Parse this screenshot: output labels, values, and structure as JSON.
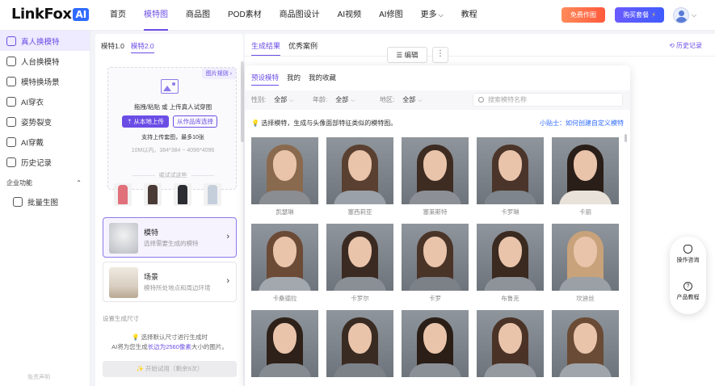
{
  "header": {
    "logo_text": "LinkFox",
    "logo_badge": "AI",
    "nav": [
      "首页",
      "模特图",
      "商品图",
      "POD素材",
      "商品图设计",
      "AI视频",
      "AI修图",
      "更多",
      "教程"
    ],
    "nav_active_index": 1,
    "more_caret": "⌵",
    "free_button": "免费作图",
    "buy_button": "购买套餐",
    "buy_icon": "⚡",
    "avatar_caret": "⌵"
  },
  "sidebar": {
    "items": [
      {
        "label": "真人换模特",
        "icon": "swap-person-icon"
      },
      {
        "label": "人台换模特",
        "icon": "mannequin-icon"
      },
      {
        "label": "模特换场景",
        "icon": "scene-icon"
      },
      {
        "label": "AI穿衣",
        "icon": "shirt-icon"
      },
      {
        "label": "姿势裂变",
        "icon": "pose-icon"
      },
      {
        "label": "AI穿戴",
        "icon": "accessory-icon"
      },
      {
        "label": "历史记录",
        "icon": "history-icon"
      }
    ],
    "active_index": 0,
    "section_title": "企业功能",
    "section_caret": "⌃",
    "sub_items": [
      {
        "label": "批量生图",
        "icon": "batch-image-icon"
      }
    ],
    "footer": "免责声明"
  },
  "config": {
    "version_tabs": [
      "模特1.0",
      "模特2.0"
    ],
    "version_active_index": 1,
    "pic_rule": "图片规则 ›",
    "upload_hint": "拖拽/粘贴 或 上传真人试穿图",
    "upload_local": "从本地上传",
    "upload_library": "从作品库选择",
    "upload_support": "支持上传套图，最多10张",
    "upload_size": "10M以内，384*384 ~ 4096*4096",
    "try_label": "或试试这些",
    "samples": [
      {
        "name": "sample-pink-top",
        "color": "#e0707a"
      },
      {
        "name": "sample-dark-coat",
        "color": "#4a3b36"
      },
      {
        "name": "sample-black-suit",
        "color": "#2b2d33"
      },
      {
        "name": "sample-light-jacket",
        "color": "#c5cfdc"
      }
    ],
    "model_card": {
      "title": "模特",
      "desc": "选择需要生成的模特"
    },
    "scene_card": {
      "title": "场景",
      "desc": "模特所处地点和周边环境"
    },
    "size_label": "设置生成尺寸",
    "size_tip1": "选择默认尺寸进行生成时",
    "size_tip2_prefix": "AI将为您生成",
    "size_tip2_highlight": "长边为2560像素",
    "size_tip2_suffix": "大小的图片。",
    "generate_button": "✨ 开始试用（剩余9次）"
  },
  "main": {
    "tabs": [
      "生成结果",
      "优秀案例"
    ],
    "active_tab": 0,
    "history": "历史记录",
    "edit_button": "编辑",
    "more_button": "⋮"
  },
  "picker": {
    "tabs": [
      "预设模特",
      "我的",
      "我的收藏"
    ],
    "active_tab": 0,
    "filters": [
      {
        "label": "性别:",
        "value": "全部"
      },
      {
        "label": "年龄:",
        "value": "全部"
      },
      {
        "label": "地区:",
        "value": "全部"
      }
    ],
    "search_placeholder": "搜索模特名称",
    "tip": "选择模特，生成与头像面部特征类似的模特图。",
    "tip_link": "小贴士：如何创建自定义模特",
    "models": [
      {
        "name": "凯瑟琳",
        "hair": "#8a6a4e",
        "top": "#8a8d92"
      },
      {
        "name": "塞西莉亚",
        "hair": "#5a4030",
        "top": "#9ba1a8"
      },
      {
        "name": "塞莱斯特",
        "hair": "#3e2c22",
        "top": "#8c9096"
      },
      {
        "name": "卡罗琳",
        "hair": "#4b352a",
        "top": "#7f858c"
      },
      {
        "name": "卡丽",
        "hair": "#2a1e18",
        "top": "#e8e2da"
      },
      {
        "name": "卡桑德拉",
        "hair": "#6b4a36",
        "top": "#a3a8ae"
      },
      {
        "name": "卡罗尔",
        "hair": "#3a2a22",
        "top": "#8a8f95"
      },
      {
        "name": "卡罗",
        "hair": "#4a3428",
        "top": "#7c8188"
      },
      {
        "name": "布鲁克",
        "hair": "#3a2a20",
        "top": "#8e9399"
      },
      {
        "name": "坎迪丝",
        "hair": "#c8a27a",
        "top": "#9aa0a6"
      },
      {
        "name": "",
        "hair": "#2e2119",
        "top": "#868b91"
      },
      {
        "name": "",
        "hair": "#3a2b22",
        "top": "#7d8289"
      },
      {
        "name": "",
        "hair": "#2a1e17",
        "top": "#8b9096"
      },
      {
        "name": "",
        "hair": "#4a3326",
        "top": "#959aa0"
      },
      {
        "name": "",
        "hair": "#6a4b35",
        "top": "#a0a5ab"
      }
    ]
  },
  "float": {
    "consult": "操作咨询",
    "tutorial": "产品教程"
  }
}
